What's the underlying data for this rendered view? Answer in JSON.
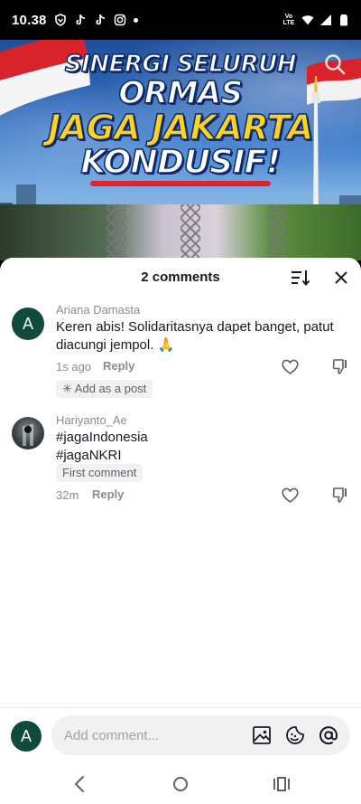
{
  "status_bar": {
    "time": "10.38",
    "left_icons": [
      "vpn-shield-icon",
      "tiktok-icon",
      "tiktok-icon",
      "instagram-icon",
      "dot-icon"
    ],
    "network_label": "Vo LTE",
    "right_icons": [
      "wifi-icon",
      "signal-icon",
      "battery-icon"
    ]
  },
  "video": {
    "headline_lines": [
      "SINERGI SELURUH",
      "ORMAS",
      "JAGA JAKARTA",
      "KONDUSIF!"
    ],
    "colors": {
      "headline_white": "#ffffff",
      "headline_yellow": "#ffd21f",
      "outline": "#0d2a6b",
      "underline_red": "#e0242e"
    }
  },
  "comments_sheet": {
    "title": "2 comments",
    "comments": [
      {
        "avatar_letter": "A",
        "username": "Ariana Damasta",
        "text": "Keren abis! Solidaritasnya dapet banget, patut diacungi jempol. 🙏",
        "time": "1s ago",
        "reply_label": "Reply",
        "action_chip": "✳ Add as a post"
      },
      {
        "username": "Hariyanto_Ae",
        "text_lines": [
          "#jagaIndonesia",
          "#jagaNKRI"
        ],
        "badge": "First comment",
        "time": "32m",
        "reply_label": "Reply"
      }
    ]
  },
  "composer": {
    "avatar_letter": "A",
    "placeholder": "Add comment...",
    "icons": [
      "image-icon",
      "emoji-sticker-icon",
      "mention-icon"
    ]
  },
  "colors": {
    "avatar_green": "#0f4a3a",
    "text_primary": "#161823",
    "text_secondary": "#8a8b91",
    "chip_bg": "#f1f1f2"
  }
}
